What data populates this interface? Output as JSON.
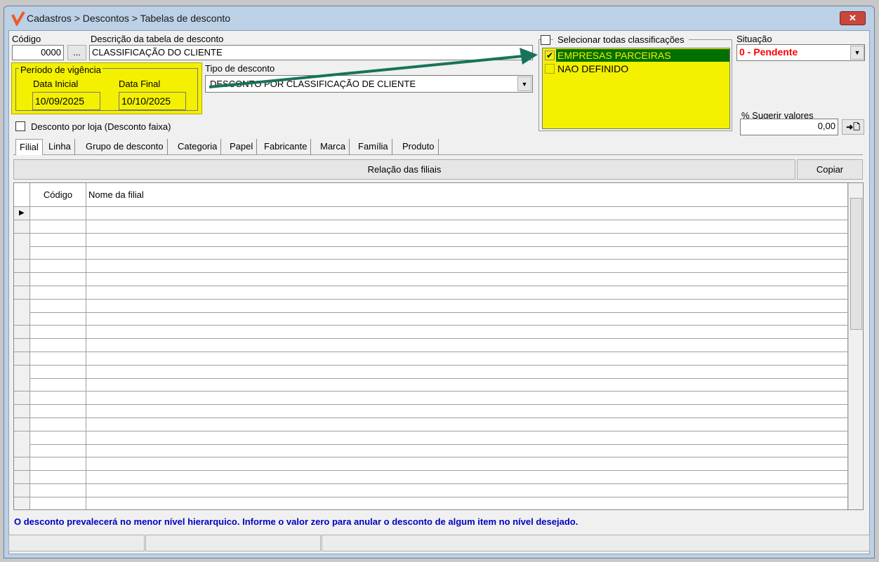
{
  "window": {
    "title": "Cadastros > Descontos > Tabelas de desconto",
    "close_label": "✕"
  },
  "form": {
    "codigo_label": "Código",
    "codigo_value": "0000",
    "lookup_label": "...",
    "descricao_label": "Descrição da tabela de desconto",
    "descricao_value": "CLASSIFICAÇÃO DO CLIENTE",
    "periodo_label": "Período de vigência",
    "data_inicial_label": "Data Inicial",
    "data_inicial_value": "10/09/2025",
    "data_final_label": "Data Final",
    "data_final_value": "10/10/2025",
    "tipo_label": "Tipo de desconto",
    "tipo_value": "DESCONTO POR CLASSIFICAÇÃO DE CLIENTE",
    "desconto_loja_label": "Desconto por loja (Desconto faixa)",
    "selecionar_todas_label": "Selecionar todas classificações",
    "classificacoes": [
      {
        "label": "EMPRESAS PARCEIRAS",
        "checked": true
      },
      {
        "label": "NAO DEFINIDO",
        "checked": false
      }
    ],
    "situacao_label": "Situação",
    "situacao_value": "0 - Pendente",
    "sugerir_label": "% Sugerir valores",
    "sugerir_value": "0,00",
    "apply_icon": "➜🗋"
  },
  "tabs": [
    "Filial",
    "Linha",
    "Grupo de desconto",
    "Categoria",
    "Papel",
    "Fabricante",
    "Marca",
    "Família",
    "Produto"
  ],
  "relacao_label": "Relação das filiais",
  "copiar_label": "Copiar",
  "grid": {
    "columns": [
      "Código",
      "Nome da filial"
    ]
  },
  "footer_note": "O desconto prevalecerá no menor nível hierarquico. Informe o valor zero para anular o desconto de algum item no nível desejado.",
  "colors": {
    "accent_yellow": "#f3f000",
    "selected_green": "#007000",
    "situacao_red": "#ff0000",
    "note_blue": "#0000c0"
  }
}
